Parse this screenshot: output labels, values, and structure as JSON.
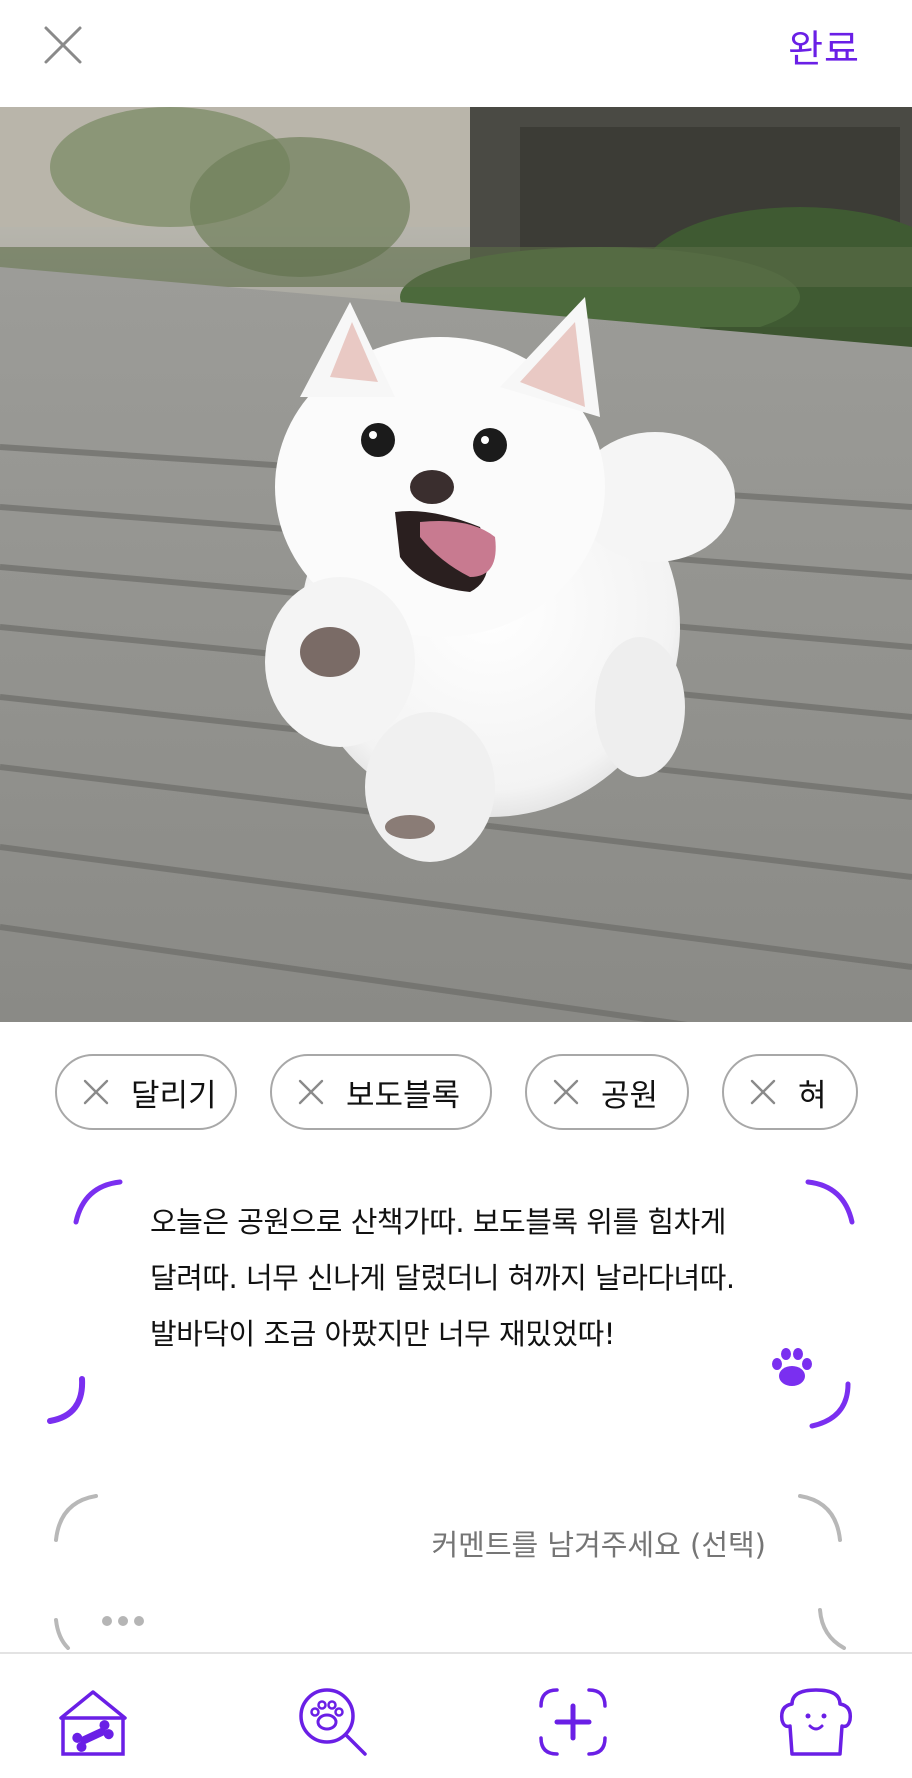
{
  "header": {
    "close_icon": "close-icon",
    "done_label": "완료"
  },
  "photo": {
    "subject": "dog-photo"
  },
  "tags": [
    {
      "label": "달리기"
    },
    {
      "label": "보도블록"
    },
    {
      "label": "공원"
    },
    {
      "label": "혀"
    }
  ],
  "diary": {
    "lines": [
      "오늘은 공원으로 산책가따. 보도블록 위를 힘차게",
      "달려따. 너무 신나게 달렸더니 혀까지 날라다녀따.",
      "발바닥이 조금 아팠지만 너무 재밌었따!"
    ],
    "icon": "paw-icon"
  },
  "comment": {
    "placeholder": "커멘트를 남겨주세요 (선택)",
    "value": ""
  },
  "nav": {
    "items": [
      "home-icon",
      "search-paw-icon",
      "add-icon",
      "profile-icon"
    ]
  },
  "colors": {
    "accent": "#6a1fe6",
    "border": "#a8a8a8",
    "placeholder": "#9a9a9a"
  }
}
